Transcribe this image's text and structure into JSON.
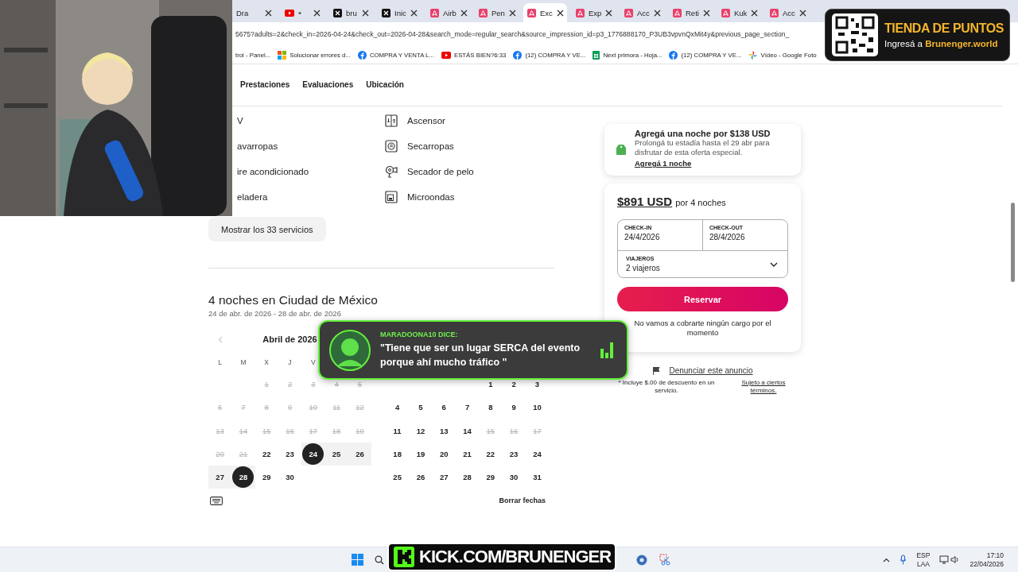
{
  "browser": {
    "tabs": [
      {
        "label": "Dra",
        "selected": false,
        "audio": false
      },
      {
        "kind": "video",
        "selected": false,
        "audio": true
      },
      {
        "kind": "social",
        "label": "bru",
        "selected": false,
        "audio": false
      },
      {
        "kind": "social",
        "label": "Inic",
        "selected": false,
        "audio": false
      },
      {
        "kind": "rental",
        "label": "Airb",
        "selected": false,
        "audio": false
      },
      {
        "kind": "rental",
        "label": "Pen",
        "selected": false,
        "audio": false
      },
      {
        "kind": "rental",
        "label": "Exc",
        "selected": true,
        "audio": false
      },
      {
        "kind": "rental",
        "label": "Exp",
        "selected": false,
        "audio": false
      },
      {
        "kind": "rental",
        "label": "Acc",
        "selected": false,
        "audio": false
      },
      {
        "kind": "rental",
        "label": "Reti",
        "selected": false,
        "audio": false
      },
      {
        "kind": "rental",
        "label": "Kuk",
        "selected": false,
        "audio": false
      },
      {
        "kind": "rental",
        "label": "Acc",
        "selected": false,
        "audio": false
      }
    ],
    "address": "5675?adults=2&check_in=2026-04-24&check_out=2026-04-28&search_mode=regular_search&source_impression_id=p3_1776888170_P3UB3vpvnQxMit4y&previous_page_section_",
    "bookmarks": [
      {
        "label": "trol - Panel..."
      },
      {
        "kind": "squares",
        "label": "Solucionar errores d..."
      },
      {
        "kind": "social",
        "label": "COMPRA Y VENTA L..."
      },
      {
        "kind": "video",
        "label": "ESTÁS BIEN?6:33"
      },
      {
        "kind": "social",
        "label": "(12) COMPRA Y VE..."
      },
      {
        "kind": "sheet",
        "label": "Next primora - Hoja..."
      },
      {
        "kind": "social",
        "label": "(12) COMPRA Y VE..."
      },
      {
        "kind": "photos",
        "label": "Vídeo - Google Foto"
      }
    ]
  },
  "page": {
    "nav": [
      "Prestaciones",
      "Evaluaciones",
      "Ubicación"
    ],
    "amenities": [
      {
        "label": "V"
      },
      {
        "kind": "elevator",
        "label": "Ascensor"
      },
      {
        "label": "avarropas"
      },
      {
        "kind": "dryer",
        "label": "Secarropas"
      },
      {
        "label": "ire acondicionado"
      },
      {
        "kind": "hairdryer",
        "label": "Secador de pelo"
      },
      {
        "label": "eladera"
      },
      {
        "kind": "microwave",
        "label": "Microondas"
      }
    ],
    "show_all_button": "Mostrar los 33 servicios",
    "stay_title": "4 noches en Ciudad de México",
    "stay_dates": "24 de abr. de 2026 - 28 de abr. de 2026",
    "calendar": {
      "months": [
        {
          "title": "Abril de 2026",
          "weekdays": [
            "L",
            "M",
            "X",
            "J",
            "V"
          ],
          "weeks": [
            {
              "kind": "leading",
              "days": [
                {
                  "label": "1",
                  "available": false,
                  "selected": false,
                  "in_range": false
                },
                {
                  "label": "2",
                  "available": false,
                  "selected": false,
                  "in_range": false
                },
                {
                  "label": "3",
                  "available": false,
                  "selected": false,
                  "in_range": false
                },
                {
                  "label": "4",
                  "available": false,
                  "selected": false,
                  "in_range": false
                },
                {
                  "label": "5",
                  "available": false,
                  "selected": false,
                  "in_range": false
                }
              ]
            },
            {
              "days": [
                {
                  "label": "6",
                  "available": false,
                  "selected": false,
                  "in_range": false
                },
                {
                  "label": "7",
                  "available": false,
                  "selected": false,
                  "in_range": false
                },
                {
                  "label": "8",
                  "available": false,
                  "selected": false,
                  "in_range": false
                },
                {
                  "label": "9",
                  "available": false,
                  "selected": false,
                  "in_range": false
                },
                {
                  "label": "10",
                  "available": false,
                  "selected": false,
                  "in_range": false
                },
                {
                  "label": "11",
                  "available": false,
                  "selected": false,
                  "in_range": false
                },
                {
                  "label": "12",
                  "available": false,
                  "selected": false,
                  "in_range": false
                }
              ]
            },
            {
              "days": [
                {
                  "label": "13",
                  "available": false,
                  "selected": false,
                  "in_range": false
                },
                {
                  "label": "14",
                  "available": false,
                  "selected": false,
                  "in_range": false
                },
                {
                  "label": "15",
                  "available": false,
                  "selected": false,
                  "in_range": false
                },
                {
                  "label": "16",
                  "available": false,
                  "selected": false,
                  "in_range": false
                },
                {
                  "label": "17",
                  "available": false,
                  "selected": false,
                  "in_range": false
                },
                {
                  "label": "18",
                  "available": false,
                  "selected": false,
                  "in_range": false
                },
                {
                  "label": "19",
                  "available": false,
                  "selected": false,
                  "in_range": false
                }
              ]
            },
            {
              "days": [
                {
                  "label": "20",
                  "available": false,
                  "selected": false,
                  "in_range": false
                },
                {
                  "label": "21",
                  "available": false,
                  "selected": false,
                  "in_range": false
                },
                {
                  "label": "22",
                  "available": true,
                  "selected": false,
                  "in_range": false
                },
                {
                  "label": "23",
                  "available": true,
                  "selected": false,
                  "in_range": false
                },
                {
                  "label": "24",
                  "available": true,
                  "selected": true,
                  "in_range": true
                },
                {
                  "label": "25",
                  "available": true,
                  "selected": false,
                  "in_range": true
                },
                {
                  "label": "26",
                  "available": true,
                  "selected": false,
                  "in_range": true
                }
              ]
            },
            {
              "days": [
                {
                  "label": "27",
                  "available": true,
                  "selected": false,
                  "in_range": true
                },
                {
                  "label": "28",
                  "available": true,
                  "selected": true,
                  "in_range": true
                },
                {
                  "label": "29",
                  "available": true,
                  "selected": false,
                  "in_range": false
                },
                {
                  "label": "30",
                  "available": true,
                  "selected": false,
                  "in_range": false
                }
              ]
            }
          ]
        },
        {
          "weeks": [
            {
              "kind": "leading",
              "days": [
                {
                  "label": "1",
                  "available": true,
                  "selected": false,
                  "in_range": false
                },
                {
                  "label": "2",
                  "available": true,
                  "selected": false,
                  "in_range": false
                },
                {
                  "label": "3",
                  "available": true,
                  "selected": false,
                  "in_range": false
                }
              ]
            },
            {
              "days": [
                {
                  "label": "4",
                  "available": true,
                  "selected": false,
                  "in_range": false
                },
                {
                  "label": "5",
                  "available": true,
                  "selected": false,
                  "in_range": false
                },
                {
                  "label": "6",
                  "available": true,
                  "selected": false,
                  "in_range": false
                },
                {
                  "label": "7",
                  "available": true,
                  "selected": false,
                  "in_range": false
                },
                {
                  "label": "8",
                  "available": true,
                  "selected": false,
                  "in_range": false
                },
                {
                  "label": "9",
                  "available": true,
                  "selected": false,
                  "in_range": false
                },
                {
                  "label": "10",
                  "available": true,
                  "selected": false,
                  "in_range": false
                }
              ]
            },
            {
              "days": [
                {
                  "label": "11",
                  "available": true,
                  "selected": false,
                  "in_range": false
                },
                {
                  "label": "12",
                  "available": true,
                  "selected": false,
                  "in_range": false
                },
                {
                  "label": "13",
                  "available": true,
                  "selected": false,
                  "in_range": false
                },
                {
                  "label": "14",
                  "available": true,
                  "selected": false,
                  "in_range": false
                },
                {
                  "label": "15",
                  "available": false,
                  "selected": false,
                  "in_range": false
                },
                {
                  "label": "16",
                  "available": false,
                  "selected": false,
                  "in_range": false
                },
                {
                  "label": "17",
                  "available": false,
                  "selected": false,
                  "in_range": false
                }
              ]
            },
            {
              "days": [
                {
                  "label": "18",
                  "available": true,
                  "selected": false,
                  "in_range": false
                },
                {
                  "label": "19",
                  "available": true,
                  "selected": false,
                  "in_range": false
                },
                {
                  "label": "20",
                  "available": true,
                  "selected": false,
                  "in_range": false
                },
                {
                  "label": "21",
                  "available": true,
                  "selected": false,
                  "in_range": false
                },
                {
                  "label": "22",
                  "available": true,
                  "selected": false,
                  "in_range": false
                },
                {
                  "label": "23",
                  "available": true,
                  "selected": false,
                  "in_range": false
                },
                {
                  "label": "24",
                  "available": true,
                  "selected": false,
                  "in_range": false
                }
              ]
            },
            {
              "days": [
                {
                  "label": "25",
                  "available": true,
                  "selected": false,
                  "in_range": false
                },
                {
                  "label": "26",
                  "available": true,
                  "selected": false,
                  "in_range": false
                },
                {
                  "label": "27",
                  "available": true,
                  "selected": false,
                  "in_range": false
                },
                {
                  "label": "28",
                  "available": true,
                  "selected": false,
                  "in_range": false
                },
                {
                  "label": "29",
                  "available": true,
                  "selected": false,
                  "in_range": false
                },
                {
                  "label": "30",
                  "available": true,
                  "selected": false,
                  "in_range": false
                },
                {
                  "label": "31",
                  "available": true,
                  "selected": false,
                  "in_range": false
                }
              ]
            }
          ]
        }
      ],
      "clear_button": "Borrar fechas"
    }
  },
  "booking": {
    "offer": {
      "title": "Agregá una noche por $138 USD",
      "text": "Prolongá tu estadía hasta el 29 abr para disfrutar de esta oferta especial.",
      "link": "Agregá 1 noche"
    },
    "price": "$891 USD",
    "price_note": "por 4 noches",
    "check_in": {
      "label": "CHECK-IN",
      "value": "24/4/2026"
    },
    "check_out": {
      "label": "CHECK-OUT",
      "value": "28/4/2026"
    },
    "guests": {
      "label": "VIAJEROS",
      "value": "2 viajeros"
    },
    "reserve_button": "Reservar",
    "notice": "No vamos a cobrarte ningún cargo por el momento",
    "report_link": "Denunciar este anuncio",
    "footnote": "* Incluye $.00 de descuento en un servicio.",
    "terms_link": "Sujeto a ciertos términos."
  },
  "overlays": {
    "promo": {
      "title": "TIENDA DE PUNTOS",
      "text": "Ingresá a **Brunenger.world**"
    },
    "chat_alert": {
      "user": "MARADOONA10 DICE:",
      "message": "\"Tiene que ser un lugar SERCA del evento porque ahí mucho tráfico \""
    },
    "banner": "KICK.COM/BRUNENGER"
  },
  "taskbar": {
    "language": "ESP",
    "layout": "LAA",
    "time": "17:10",
    "date": "22/04/2026"
  }
}
